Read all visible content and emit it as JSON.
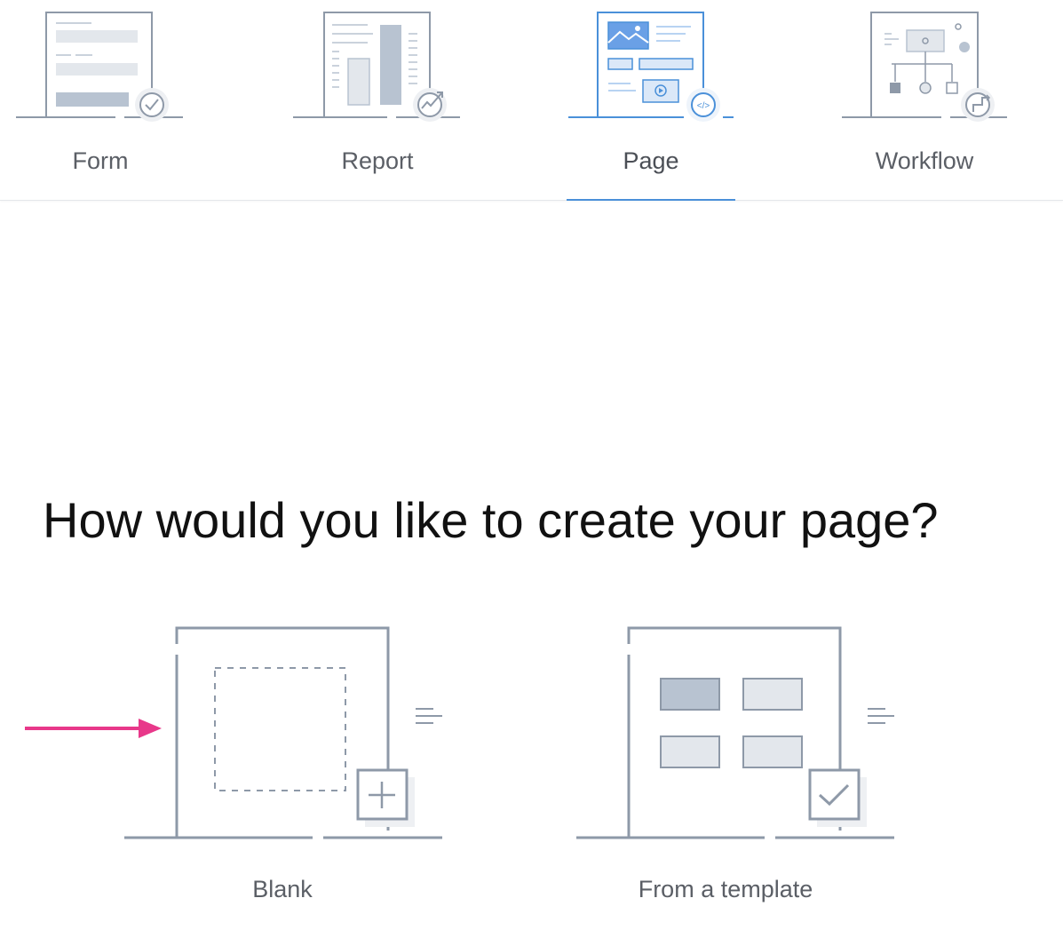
{
  "tabs": [
    {
      "label": "Form",
      "icon": "form-illustration-icon",
      "active": false
    },
    {
      "label": "Report",
      "icon": "report-illustration-icon",
      "active": false
    },
    {
      "label": "Page",
      "icon": "page-illustration-icon",
      "active": true
    },
    {
      "label": "Workflow",
      "icon": "workflow-illustration-icon",
      "active": false
    }
  ],
  "question": "How would you like to create your page?",
  "options": [
    {
      "label": "Blank",
      "icon": "blank-page-icon"
    },
    {
      "label": "From a template",
      "icon": "template-page-icon"
    }
  ],
  "colors": {
    "accent": "#4a90d9",
    "line": "#8e99a8",
    "fill": "#b8c3d1",
    "light_fill": "#e3e7ec",
    "arrow": "#e8388a"
  }
}
